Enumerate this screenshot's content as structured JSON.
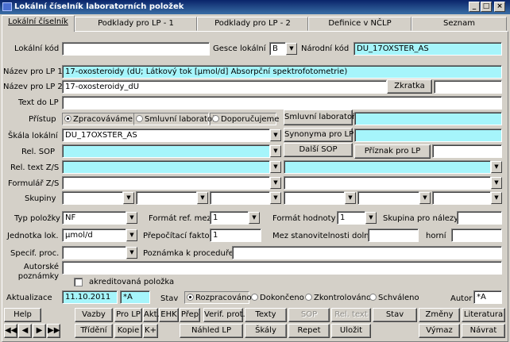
{
  "window": {
    "title": "Lokální číselník laboratorních položek",
    "min": "_",
    "max": "□",
    "close": "×"
  },
  "tabs": [
    "Lokální číselník",
    "Podklady pro LP - 1",
    "Podklady pro LP - 2",
    "Definice v NČLP",
    "Seznam"
  ],
  "form": {
    "lokalni_kod_label": "Lokální kód",
    "lokalni_kod": "",
    "gesce_label": "Gesce lokální",
    "gesce": "B",
    "narodni_kod_label": "Národní kód",
    "narodni_kod": "DU_17OXSTER_AS",
    "nazev1_label": "Název pro LP 1",
    "nazev1": "17-oxosteroidy (dU; Látkový tok [μmol/d] Absorpční spektrofotometrie)",
    "nazev2_label": "Název pro LP 2",
    "nazev2": "17-oxosteroidy_dU",
    "zkratka_button": "Zkratka",
    "zkratka": "",
    "text_do_lp_label": "Text do LP",
    "text_do_lp": "",
    "pristup_label": "Přístup",
    "pristup_options": [
      "Zpracováváme",
      "Smluvní laboratoř",
      "Doporučujeme"
    ],
    "pristup_selected": 0,
    "smluvni_button": "Smluvní laboratoř",
    "smluvni": "",
    "skala_label": "Škála lokální",
    "skala": "DU_17OXSTER_AS",
    "synonyma_button": "Synonyma pro LP",
    "synonyma": "",
    "rel_sop_label": "Rel. SOP",
    "rel_sop": "",
    "dalsi_sop_button": "Další SOP",
    "priznak_button": "Příznak pro LP",
    "priznak": "",
    "rel_text_label": "Rel. text Z/S",
    "rel_text": "",
    "rel_text2": "",
    "formular_label": "Formulář Z/S",
    "formular": "",
    "formular2": "",
    "skupiny_label": "Skupiny",
    "typ_label": "Typ položky",
    "typ": "NF",
    "format_meze_label": "Formát ref. mezí",
    "format_meze": "1",
    "format_hodnoty_label": "Formát hodnoty",
    "format_hodnoty": "1",
    "skupina_nalezy_label": "Skupina pro nálezy",
    "skupina_nalezy": "",
    "jednotka_label": "Jednotka lok.",
    "jednotka": "μmol/d",
    "prepocitaci_label": "Přepočítací faktor",
    "prepocitaci": "1",
    "mez_label": "Mez stanovitelnosti dolní",
    "mez_dolni": "",
    "horni_label": "horní",
    "mez_horni": "",
    "specif_label": "Specif. proc.",
    "specif": "",
    "poznamka_label": "Poznámka k proceduře",
    "poznamka": "",
    "autorske_label1": "Autorské",
    "autorske_label2": "poznámky",
    "autorske": "",
    "akreditovana_label": "akreditovaná položka",
    "aktualizace_label": "Aktualizace",
    "aktualizace_datum": "11.10.2011",
    "aktualizace_autor": "*A",
    "stav_label": "Stav",
    "stav_options": [
      "Rozpracováno",
      "Dokončeno",
      "Zkontrolováno",
      "Schváleno"
    ],
    "stav_selected": 0,
    "autor_label": "Autor",
    "autor": "*A"
  },
  "buttons_row1": [
    "Help",
    "Vazby",
    "Pro LP",
    "Akt.",
    "EHK",
    "Přep",
    "Verif. prot.",
    "Texty",
    "SOP",
    "Rel. text",
    "Stav",
    "Změny",
    "Literatura"
  ],
  "buttons_row2": [
    "Třídění",
    "Kopie",
    "K+",
    "Náhled LP",
    "Škály",
    "Repet",
    "Uložit",
    "Výmaz",
    "Návrat"
  ],
  "nav_icons": [
    "first-record-icon",
    "prev-record-icon",
    "next-record-icon",
    "last-record-icon"
  ],
  "accent": "#a6f5fb"
}
